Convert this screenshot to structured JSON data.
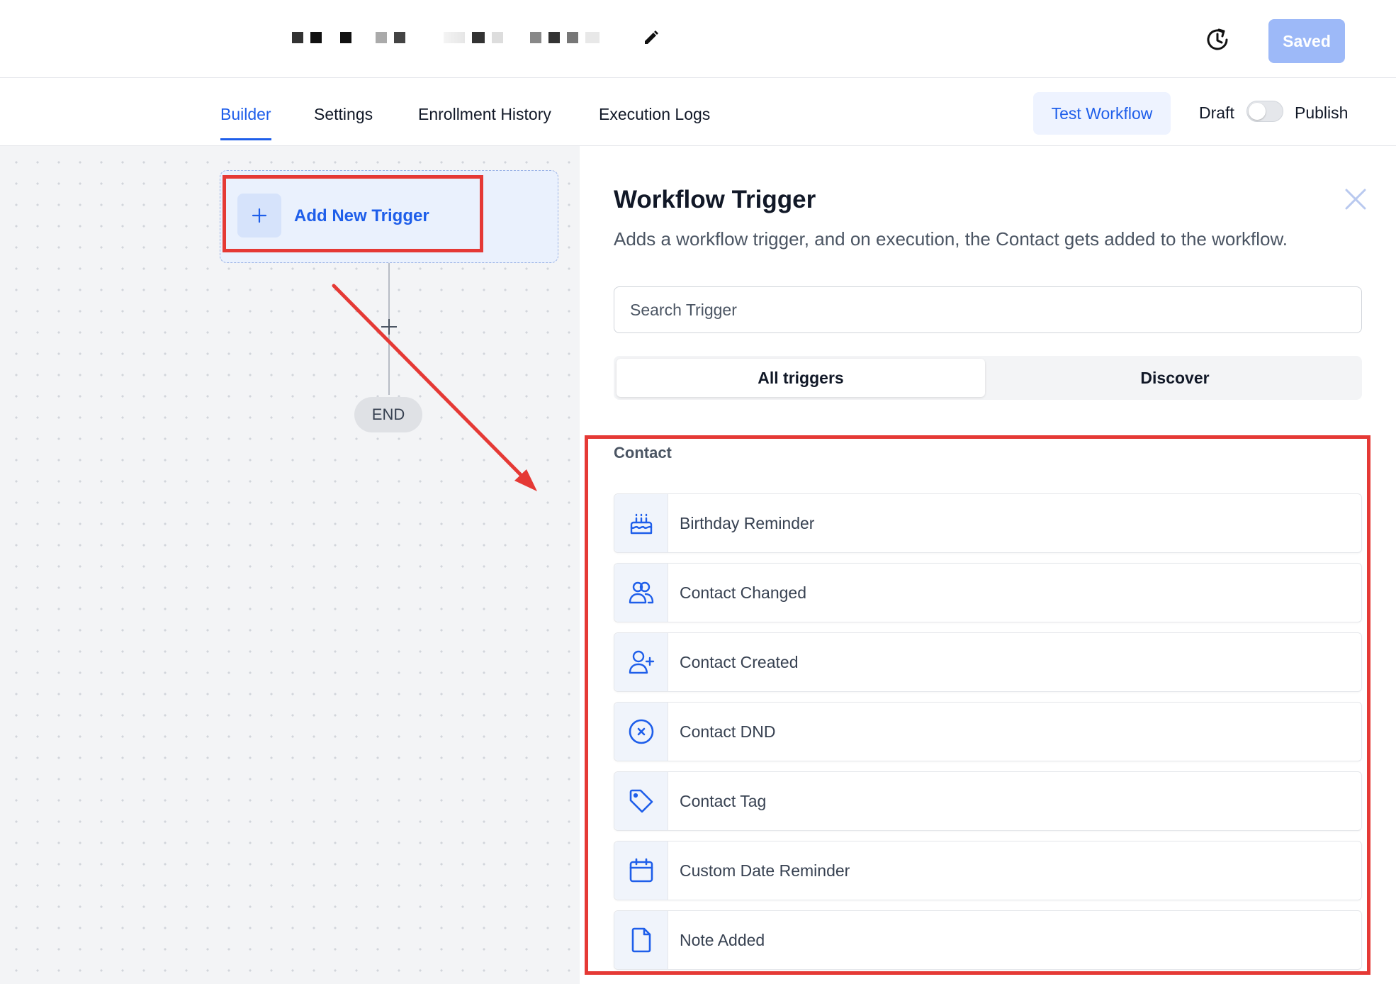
{
  "header": {
    "history_icon": "history-icon",
    "edit_icon": "pencil-icon",
    "saved_label": "Saved"
  },
  "tabs": [
    {
      "label": "Builder",
      "active": true
    },
    {
      "label": "Settings",
      "active": false
    },
    {
      "label": "Enrollment History",
      "active": false
    },
    {
      "label": "Execution Logs",
      "active": false
    }
  ],
  "actions": {
    "test_workflow_label": "Test Workflow",
    "draft_label": "Draft",
    "publish_label": "Publish",
    "publish_toggle_on": false
  },
  "canvas": {
    "add_trigger_label": "Add New Trigger",
    "add_trigger_icon": "plus-icon",
    "add_step_icon": "plus-icon",
    "end_label": "END"
  },
  "panel": {
    "title": "Workflow Trigger",
    "subtitle": "Adds a workflow trigger, and on execution, the Contact gets added to the workflow.",
    "close_icon": "close-icon",
    "search_placeholder": "Search Trigger",
    "segments": [
      {
        "label": "All triggers",
        "active": true
      },
      {
        "label": "Discover",
        "active": false
      }
    ],
    "section_label": "Contact",
    "triggers": [
      {
        "label": "Birthday Reminder",
        "icon": "birthday-cake-icon"
      },
      {
        "label": "Contact Changed",
        "icon": "users-icon"
      },
      {
        "label": "Contact Created",
        "icon": "user-plus-icon"
      },
      {
        "label": "Contact DND",
        "icon": "circle-x-icon"
      },
      {
        "label": "Contact Tag",
        "icon": "tag-icon"
      },
      {
        "label": "Custom Date Reminder",
        "icon": "calendar-icon"
      },
      {
        "label": "Note Added",
        "icon": "document-icon"
      }
    ]
  },
  "colors": {
    "accent": "#1e5eea",
    "saved_button": "#9db9f8",
    "annotation": "#e53935",
    "canvas_bg": "#f3f4f6"
  }
}
